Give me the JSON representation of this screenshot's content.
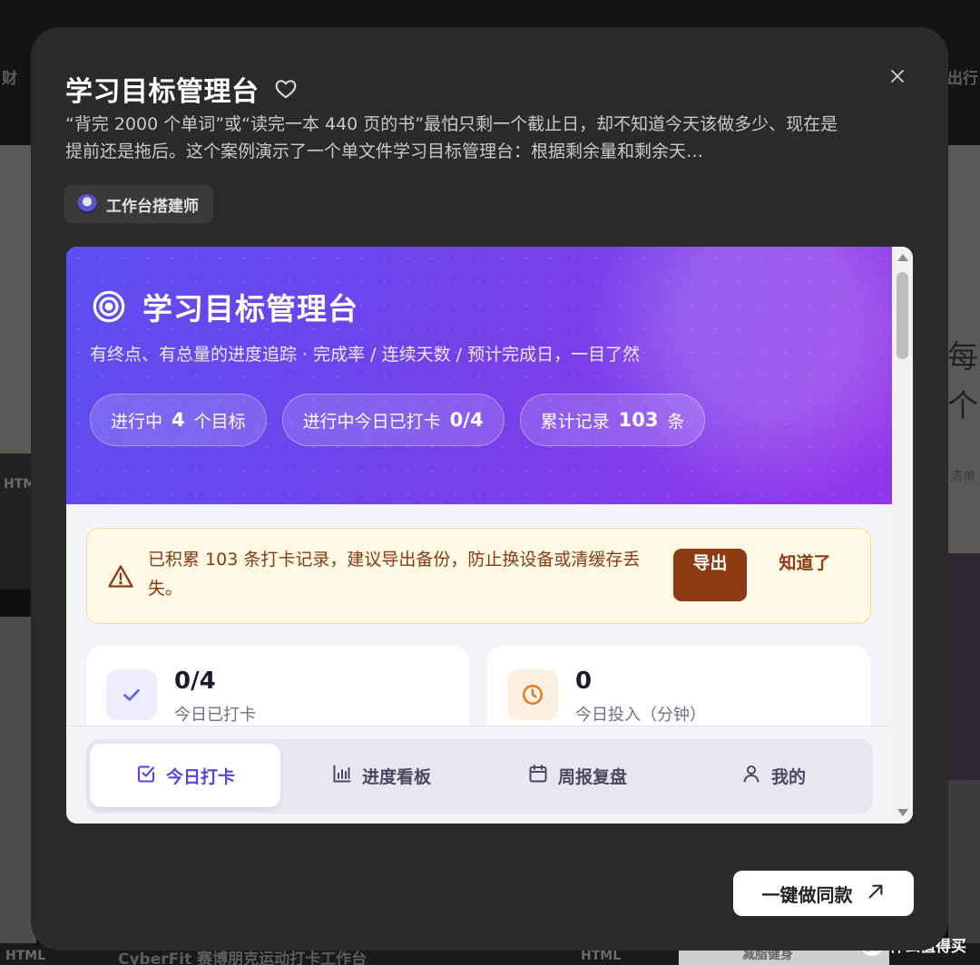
{
  "background": {
    "nav_left": "财",
    "nav_right": "出行",
    "html_badge": "HTML",
    "char_1": "每",
    "char_2": "个",
    "right_snippet": "清单",
    "bottom_card_title": "CyberFit 赛博朋克运动打卡工作台",
    "bottom_card_right": "减脂健身",
    "watermark": "什么值得买",
    "watermark_logo": "值"
  },
  "modal": {
    "title": "学习目标管理台",
    "description": "“背完 2000 个单词”或“读完一本 440 页的书”最怕只剩一个截止日，却不知道今天该做多少、现在是提前还是拖后。这个案例演示了一个单文件学习目标管理台：根据剩余量和剩余天…",
    "author": "工作台搭建师",
    "cta_label": "一键做同款",
    "icons": {
      "favorite": "heart-icon",
      "close": "close-icon",
      "cta": "arrow-up-right-icon"
    }
  },
  "app": {
    "title": "学习目标管理台",
    "subtitle": "有终点、有总量的进度追踪 · 完成率 / 连续天数 / 预计完成日，一目了然",
    "chips": [
      {
        "prefix": "进行中",
        "value": "4",
        "suffix": "个目标"
      },
      {
        "prefix": "进行中今日已打卡",
        "value": "0/4",
        "suffix": ""
      },
      {
        "prefix": "累计记录",
        "value": "103",
        "suffix": "条"
      }
    ],
    "alert": {
      "text": "已积累 103 条打卡记录，建议导出备份，防止换设备或清缓存丢失。",
      "export_label": "导出",
      "dismiss_label": "知道了"
    },
    "stats": [
      {
        "value": "0/4",
        "label": "今日已打卡",
        "icon": "check-icon"
      },
      {
        "value": "0",
        "label": "今日投入（分钟）",
        "icon": "clock-icon"
      }
    ],
    "tabs": [
      {
        "label": "今日打卡",
        "icon": "checkbox-icon",
        "active": true
      },
      {
        "label": "进度看板",
        "icon": "bar-chart-icon",
        "active": false
      },
      {
        "label": "周报复盘",
        "icon": "calendar-icon",
        "active": false
      },
      {
        "label": "我的",
        "icon": "user-icon",
        "active": false
      }
    ]
  },
  "colors": {
    "modal_bg": "#2a2a2a",
    "accent": "#5346e0",
    "hero_start": "#5b4ff0",
    "hero_end": "#9336ea",
    "alert_brown": "#8b3a12",
    "alert_bg": "#fef8e4"
  }
}
